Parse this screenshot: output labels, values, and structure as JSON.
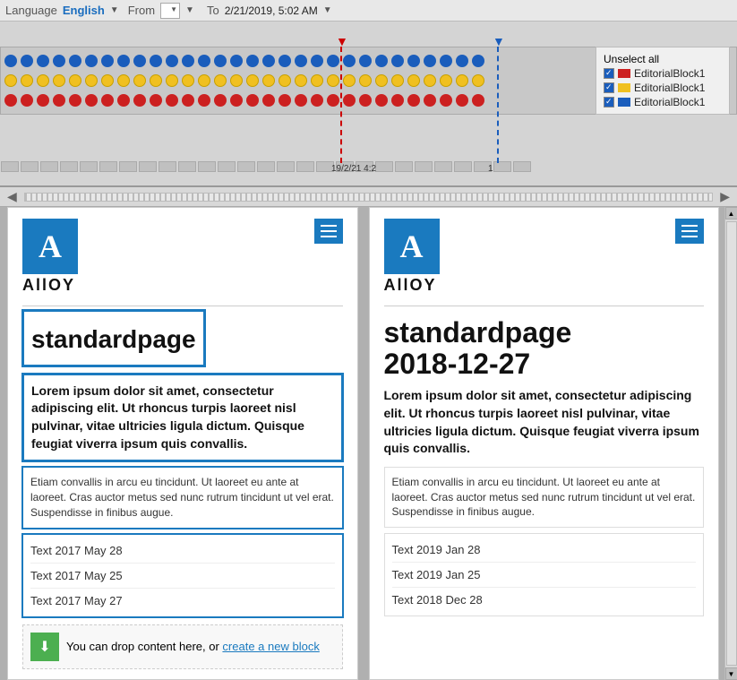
{
  "topbar": {
    "language_label": "Language",
    "language_value": "English",
    "from_label": "From",
    "from_placeholder": "",
    "to_label": "To",
    "to_value": "2/21/2019, 5:02 AM"
  },
  "legend": {
    "unselect_all": "Unselect all",
    "items": [
      {
        "label": "EditorialBlock1",
        "color": "#cc2020"
      },
      {
        "label": "EditorialBlock1",
        "color": "#f0c020"
      },
      {
        "label": "EditorialBlock1",
        "color": "#1a5dbc"
      }
    ]
  },
  "timeline": {
    "tick_label": "19/2/21 4:2",
    "tick_label2": "1"
  },
  "panel1": {
    "logo_letter": "A",
    "logo_name": "AllOY",
    "title": "standardpage",
    "intro_bold": "Lorem ipsum dolor sit amet, consectetur adipiscing elit. Ut rhoncus turpis laoreet nisl pulvinar, vitae ultricies ligula dictum. Quisque feugiat viverra ipsum quis convallis.",
    "sub_text": "Etiam convallis in arcu eu tincidunt. Ut laoreet eu ante at laoreet. Cras auctor metus sed nunc rutrum tincidunt ut vel erat. Suspendisse in finibus augue.",
    "links": [
      "Text 2017 May 28",
      "Text 2017 May 25",
      "Text 2017 May 27"
    ],
    "drop_text": "You can drop content here, or ",
    "drop_link": "create a new block"
  },
  "panel2": {
    "logo_letter": "A",
    "logo_name": "AllOY",
    "title": "standardpage",
    "title2": "2018-12-27",
    "intro_bold": "Lorem ipsum dolor sit amet, consectetur adipiscing elit. Ut rhoncus turpis laoreet nisl pulvinar, vitae ultricies ligula dictum. Quisque feugiat viverra ipsum quis convallis.",
    "sub_text": "Etiam convallis in arcu eu tincidunt. Ut laoreet eu ante at laoreet. Cras auctor metus sed nunc rutrum tincidunt ut vel erat. Suspendisse in finibus augue.",
    "links": [
      "Text 2019 Jan 28",
      "Text 2019 Jan 25",
      "Text 2018 Dec 28"
    ]
  }
}
